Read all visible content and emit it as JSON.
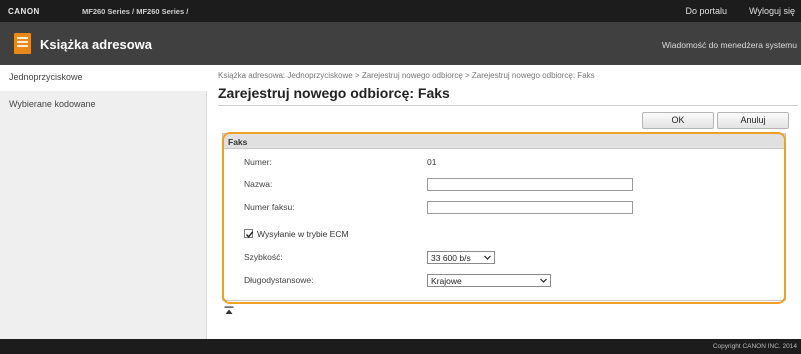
{
  "topbar": {
    "brand": "CANON",
    "model": "MF260 Series / MF260 Series /",
    "portal_link": "Do portalu",
    "logout_link": "Wyloguj się"
  },
  "app": {
    "title": "Książka adresowa",
    "icon": "address-book-icon",
    "admin_message": "Wiadomość do menedżera systemu"
  },
  "sidebar": {
    "items": [
      {
        "label": "Jednoprzyciskowe",
        "active": true
      },
      {
        "label": "Wybierane kodowane",
        "active": false
      }
    ]
  },
  "main": {
    "breadcrumb": "Książka adresowa: Jednoprzyciskowe > Zarejestruj nowego odbiorcę > Zarejestruj nowego odbiorcę: Faks",
    "title": "Zarejestruj nowego odbiorcę: Faks",
    "ok_label": "OK",
    "cancel_label": "Anuluj"
  },
  "fax": {
    "header": "Faks",
    "number_label": "Numer:",
    "number_value": "01",
    "name_label": "Nazwa:",
    "name_value": "",
    "fax_number_label": "Numer faksu:",
    "fax_number_value": "",
    "ecm_label": "Wysyłanie w trybie ECM",
    "ecm_checked": true,
    "speed_label": "Szybkość:",
    "speed_value": "33 600 b/s",
    "long_distance_label": "Długodystansowe:",
    "long_distance_value": "Krajowe"
  },
  "footer": {
    "copyright": "Copyright CANON INC. 2014"
  },
  "colors": {
    "highlight": "#f0a024",
    "app_icon": "#e88a1a",
    "topbar": "#1c1c1c",
    "appbar": "#404040"
  }
}
